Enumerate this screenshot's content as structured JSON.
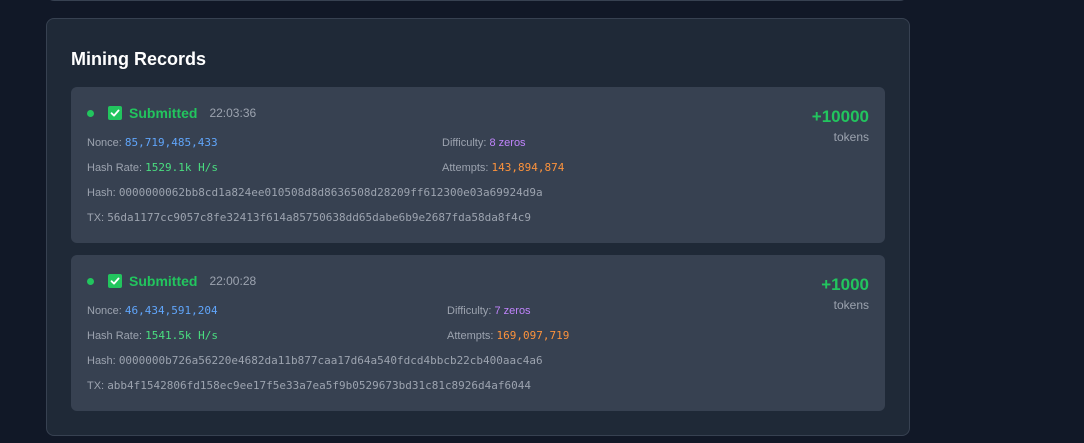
{
  "section": {
    "title": "Mining Records"
  },
  "labels": {
    "nonce": "Nonce:",
    "difficulty": "Difficulty:",
    "hash_rate": "Hash Rate:",
    "attempts": "Attempts:",
    "hash": "Hash:",
    "tx": "TX:"
  },
  "colors": {
    "success": "#22c55e",
    "nonce": "#60a5fa",
    "difficulty": "#c084fc",
    "attempts": "#fb923c"
  },
  "records": [
    {
      "status": "Submitted",
      "time": "22:03:36",
      "nonce": "85,719,485,433",
      "difficulty": "8 zeros",
      "hash_rate": "1529.1k H/s",
      "attempts": "143,894,874",
      "hash": "0000000062bb8cd1a824ee010508d8d8636508d28209ff612300e03a69924d9a",
      "tx": "56da1177cc9057c8fe32413f614a85750638dd65dabe6b9e2687fda58da8f4c9",
      "reward": "+10000",
      "reward_unit": "tokens"
    },
    {
      "status": "Submitted",
      "time": "22:00:28",
      "nonce": "46,434,591,204",
      "difficulty": "7 zeros",
      "hash_rate": "1541.5k H/s",
      "attempts": "169,097,719",
      "hash": "0000000b726a56220e4682da11b877caa17d64a540fdcd4bbcb22cb400aac4a6",
      "tx": "abb4f1542806fd158ec9ee17f5e33a7ea5f9b0529673bd31c81c8926d4af6044",
      "reward": "+1000",
      "reward_unit": "tokens"
    }
  ]
}
